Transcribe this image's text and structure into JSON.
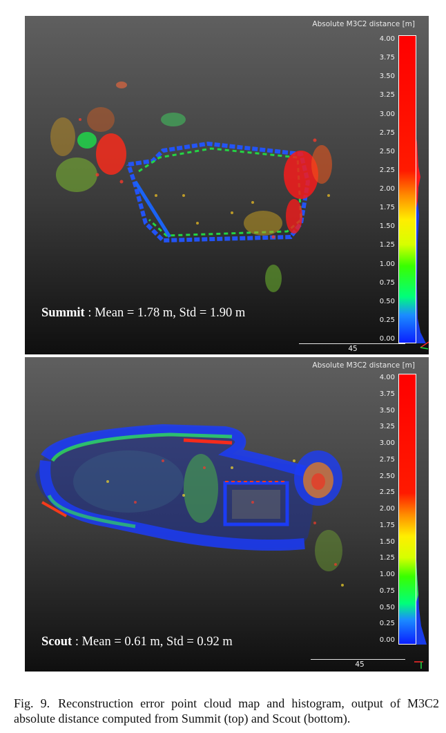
{
  "colors": {
    "scale_low": "#0a1fff",
    "scale_mid_low": "#39ff00",
    "scale_mid": "#ffee00",
    "scale_high": "#ff0000",
    "panel_top": "#5f5f5f",
    "panel_bottom": "#0f0f0f"
  },
  "panels": [
    {
      "scale_title": "Absolute M3C2 distance [m]",
      "ticks": [
        "4.00",
        "3.75",
        "3.50",
        "3.25",
        "3.00",
        "2.75",
        "2.50",
        "2.25",
        "2.00",
        "1.75",
        "1.50",
        "1.25",
        "1.00",
        "0.75",
        "0.50",
        "0.25",
        "0.00"
      ],
      "stats_name": "Summit",
      "stats_text": " : Mean = 1.78 m, Std = 1.90 m",
      "mean_m": 1.78,
      "std_m": 1.9,
      "scale_bar_label": "45"
    },
    {
      "scale_title": "Absolute M3C2 distance [m]",
      "ticks": [
        "4.00",
        "3.75",
        "3.50",
        "3.25",
        "3.00",
        "2.75",
        "2.50",
        "2.25",
        "2.00",
        "1.75",
        "1.50",
        "1.25",
        "1.00",
        "0.75",
        "0.50",
        "0.25",
        "0.00"
      ],
      "stats_name": "Scout",
      "stats_text": " : Mean = 0.61 m, Std = 0.92 m",
      "mean_m": 0.61,
      "std_m": 0.92,
      "scale_bar_label": "45"
    }
  ],
  "caption": {
    "fig_num": "Fig. 9.",
    "text": "Reconstruction error point cloud map and histogram, output of M3C2 absolute distance computed from Summit (top) and Scout (bottom)."
  }
}
